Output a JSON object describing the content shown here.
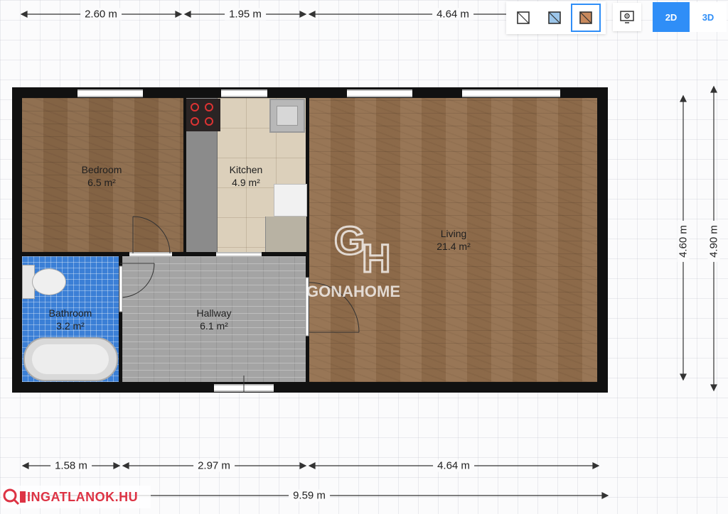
{
  "toolbar": {
    "view_buttons": [
      "floor-plan-outline-icon",
      "floor-plan-blue-icon",
      "floor-plan-textured-icon",
      "settings-monitor-icon"
    ],
    "mode_2d": "2D",
    "mode_3d": "3D",
    "active_mode": "2D",
    "accent_color": "#2f8ef7"
  },
  "rooms": {
    "bedroom": {
      "name": "Bedroom",
      "area": "6.5 m²"
    },
    "kitchen": {
      "name": "Kitchen",
      "area": "4.9 m²"
    },
    "living": {
      "name": "Living",
      "area": "21.4 m²"
    },
    "bathroom": {
      "name": "Bathroom",
      "area": "3.2 m²"
    },
    "hallway": {
      "name": "Hallway",
      "area": "6.1 m²"
    }
  },
  "dimensions": {
    "top": [
      "2.60 m",
      "1.95 m",
      "4.64 m"
    ],
    "bottom": [
      "1.58 m",
      "2.97 m",
      "4.64 m"
    ],
    "total": "9.59 m",
    "right_inner": "4.60 m",
    "right_outer": "4.90 m"
  },
  "watermark": {
    "brand": "GONAHOME",
    "monogram": "GH"
  },
  "footer_logo": "INGATLANOK.HU"
}
